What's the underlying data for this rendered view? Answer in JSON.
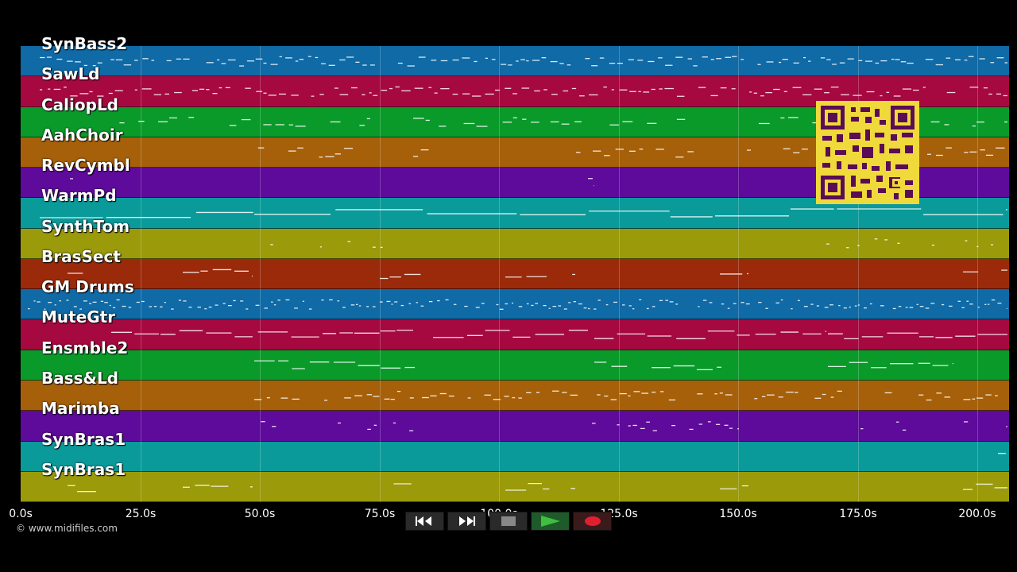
{
  "tracks": [
    {
      "name": "SynBass2",
      "color": "#0f6aa6"
    },
    {
      "name": "SawLd",
      "color": "#a6093f"
    },
    {
      "name": "CaliopLd",
      "color": "#0a9a2a"
    },
    {
      "name": "AahChoir",
      "color": "#a6600a"
    },
    {
      "name": "RevCymbl",
      "color": "#5e0a9a"
    },
    {
      "name": "WarmPd",
      "color": "#0a9a9a"
    },
    {
      "name": "SynthTom",
      "color": "#9a9a0a"
    },
    {
      "name": "BrasSect",
      "color": "#9a2a0a"
    },
    {
      "name": "GM Drums",
      "color": "#0f6aa6"
    },
    {
      "name": "MuteGtr",
      "color": "#a6093f"
    },
    {
      "name": "Ensmble2",
      "color": "#0a9a2a"
    },
    {
      "name": "Bass&Ld",
      "color": "#a6600a"
    },
    {
      "name": "Marimba",
      "color": "#5e0a9a"
    },
    {
      "name": "SynBras1",
      "color": "#0a9a9a"
    },
    {
      "name": "SynBras1",
      "color": "#9a9a0a"
    }
  ],
  "timeline": {
    "ticks": [
      "0.0s",
      "25.0s",
      "50.0s",
      "75.0s",
      "100.0s",
      "125.0s",
      "150.0s",
      "175.0s",
      "200.0s"
    ]
  },
  "footer": {
    "copyright": "© www.midifiles.com"
  },
  "transport": {
    "rewind_icon": "rewind-icon",
    "fast_forward_icon": "fast-forward-icon",
    "stop_icon": "stop-icon",
    "play_icon": "play-icon",
    "record_icon": "record-icon"
  },
  "qr_code": {
    "icon": "qr-code",
    "color": "#f0d93a"
  }
}
